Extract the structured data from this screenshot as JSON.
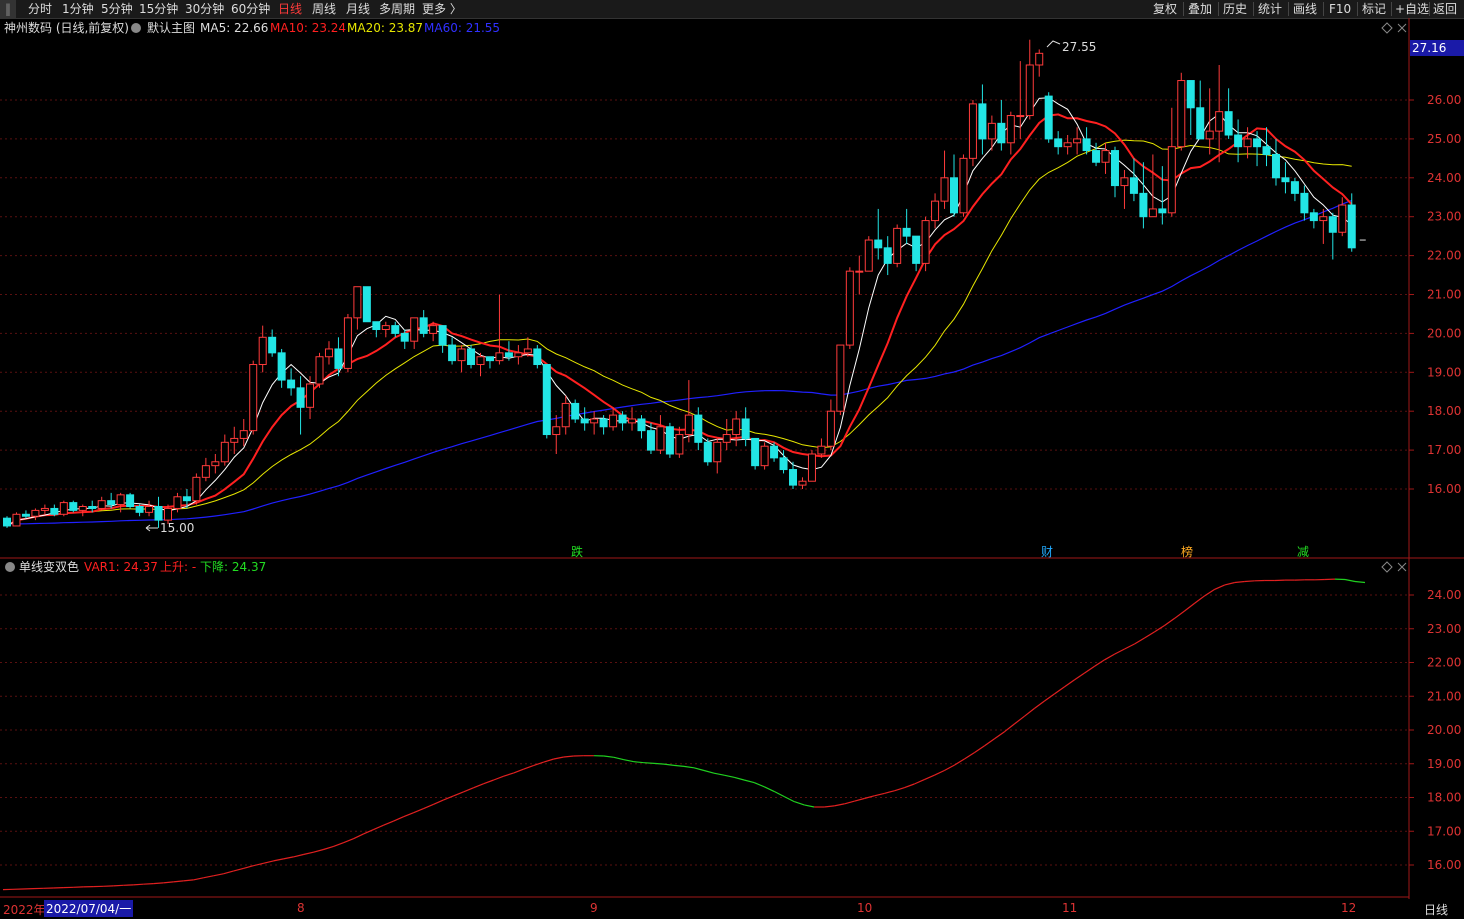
{
  "toolbar": {
    "periods": [
      "分时",
      "1分钟",
      "5分钟",
      "15分钟",
      "30分钟",
      "60分钟",
      "日线",
      "周线",
      "月线",
      "多周期",
      "更多 〉"
    ],
    "active_index": 6,
    "right": [
      "复权",
      "叠加",
      "历史",
      "统计",
      "画线",
      "F10",
      "标记",
      "+自选",
      "返回"
    ]
  },
  "main_header": {
    "stock": "神州数码 (日线,前复权)",
    "template": "默认主图",
    "ma5": "MA5: 22.66",
    "ma10": "MA10: 23.24",
    "ma20": "MA20: 23.87",
    "ma60": "MA60: 21.55",
    "current_price": "27.16"
  },
  "sub_header": {
    "name": "单线变双色",
    "var1": "VAR1: 24.37",
    "up": "上升: -",
    "down": "下降: 24.37"
  },
  "bottom": {
    "date_prefix": "2022年",
    "date_box": "2022/07/04/一",
    "months": [
      "8",
      "9",
      "10",
      "11",
      "12"
    ],
    "period_label": "日线"
  },
  "colors": {
    "up": "#ff3b3b",
    "down": "#22e5e5",
    "ma5": "#ffffff",
    "ma10": "#ff2020",
    "ma20": "#e6e600",
    "ma60": "#2020ff",
    "var_up": "#e02020",
    "var_down": "#20d020"
  },
  "chart_data": [
    {
      "type": "candlestick",
      "name": "main",
      "ylim": [
        15.0,
        27.5
      ],
      "yticks": [
        16.0,
        17.0,
        18.0,
        19.0,
        20.0,
        21.0,
        22.0,
        23.0,
        24.0,
        25.0,
        26.0
      ],
      "annotations": [
        {
          "text": "27.55",
          "type": "high"
        },
        {
          "text": "15.00",
          "type": "low"
        }
      ],
      "markers": [
        "跌",
        "财",
        "榜",
        "减"
      ],
      "ohlc": [
        [
          15.25,
          15.3,
          15.0,
          15.05
        ],
        [
          15.05,
          15.4,
          15.05,
          15.35
        ],
        [
          15.35,
          15.45,
          15.25,
          15.3
        ],
        [
          15.3,
          15.5,
          15.2,
          15.45
        ],
        [
          15.45,
          15.6,
          15.35,
          15.5
        ],
        [
          15.5,
          15.6,
          15.3,
          15.35
        ],
        [
          15.35,
          15.7,
          15.3,
          15.65
        ],
        [
          15.65,
          15.7,
          15.4,
          15.45
        ],
        [
          15.45,
          15.6,
          15.3,
          15.55
        ],
        [
          15.55,
          15.7,
          15.4,
          15.5
        ],
        [
          15.5,
          15.8,
          15.45,
          15.7
        ],
        [
          15.7,
          15.9,
          15.5,
          15.6
        ],
        [
          15.6,
          15.9,
          15.4,
          15.85
        ],
        [
          15.85,
          15.9,
          15.5,
          15.55
        ],
        [
          15.55,
          15.6,
          15.3,
          15.4
        ],
        [
          15.4,
          15.7,
          15.3,
          15.55
        ],
        [
          15.55,
          15.8,
          15.0,
          15.2
        ],
        [
          15.2,
          15.6,
          15.1,
          15.5
        ],
        [
          15.5,
          15.9,
          15.4,
          15.8
        ],
        [
          15.8,
          16.0,
          15.5,
          15.7
        ],
        [
          15.7,
          16.4,
          15.6,
          16.3
        ],
        [
          16.3,
          16.8,
          16.2,
          16.6
        ],
        [
          16.6,
          16.9,
          16.4,
          16.7
        ],
        [
          16.7,
          17.4,
          16.6,
          17.2
        ],
        [
          17.2,
          17.6,
          16.9,
          17.3
        ],
        [
          17.3,
          17.8,
          17.1,
          17.5
        ],
        [
          17.5,
          19.3,
          17.4,
          19.2
        ],
        [
          19.2,
          20.2,
          19.0,
          19.9
        ],
        [
          19.9,
          20.1,
          19.4,
          19.5
        ],
        [
          19.5,
          19.6,
          18.6,
          18.8
        ],
        [
          18.8,
          19.1,
          18.4,
          18.6
        ],
        [
          18.6,
          18.9,
          17.4,
          18.1
        ],
        [
          18.1,
          18.9,
          17.8,
          18.7
        ],
        [
          18.7,
          19.5,
          18.6,
          19.4
        ],
        [
          19.4,
          19.8,
          19.2,
          19.6
        ],
        [
          19.6,
          19.9,
          18.9,
          19.1
        ],
        [
          19.1,
          20.5,
          19.0,
          20.4
        ],
        [
          20.4,
          21.2,
          20.1,
          21.2
        ],
        [
          21.2,
          21.2,
          20.3,
          20.3
        ],
        [
          20.3,
          20.3,
          19.9,
          20.1
        ],
        [
          20.1,
          20.3,
          19.9,
          20.2
        ],
        [
          20.2,
          20.3,
          19.9,
          20.0
        ],
        [
          20.0,
          20.1,
          19.6,
          19.8
        ],
        [
          19.8,
          20.4,
          19.6,
          20.4
        ],
        [
          20.4,
          20.6,
          19.9,
          20.0
        ],
        [
          20.0,
          20.3,
          19.8,
          20.2
        ],
        [
          20.2,
          20.2,
          19.5,
          19.7
        ],
        [
          19.7,
          19.9,
          19.2,
          19.3
        ],
        [
          19.3,
          19.7,
          19.0,
          19.6
        ],
        [
          19.6,
          19.7,
          19.1,
          19.2
        ],
        [
          19.2,
          19.5,
          18.9,
          19.4
        ],
        [
          19.4,
          19.4,
          19.1,
          19.3
        ],
        [
          19.3,
          21.0,
          19.2,
          19.5
        ],
        [
          19.5,
          19.8,
          19.3,
          19.4
        ],
        [
          19.4,
          19.7,
          19.2,
          19.5
        ],
        [
          19.5,
          19.9,
          19.4,
          19.6
        ],
        [
          19.6,
          19.7,
          19.1,
          19.2
        ],
        [
          19.2,
          19.2,
          17.3,
          17.4
        ],
        [
          17.4,
          17.9,
          16.9,
          17.6
        ],
        [
          17.6,
          18.4,
          17.4,
          18.2
        ],
        [
          18.2,
          18.3,
          17.7,
          17.8
        ],
        [
          17.8,
          18.1,
          17.5,
          17.7
        ],
        [
          17.7,
          18.0,
          17.4,
          17.8
        ],
        [
          17.8,
          17.9,
          17.4,
          17.6
        ],
        [
          17.6,
          18.1,
          17.5,
          17.9
        ],
        [
          17.9,
          18.0,
          17.5,
          17.7
        ],
        [
          17.7,
          18.1,
          17.5,
          17.8
        ],
        [
          17.8,
          17.9,
          17.3,
          17.5
        ],
        [
          17.5,
          17.7,
          16.9,
          17.0
        ],
        [
          17.0,
          17.9,
          16.9,
          17.6
        ],
        [
          17.6,
          17.7,
          16.8,
          16.9
        ],
        [
          16.9,
          17.6,
          16.8,
          17.4
        ],
        [
          17.4,
          18.8,
          17.2,
          17.9
        ],
        [
          17.9,
          18.1,
          17.0,
          17.2
        ],
        [
          17.2,
          17.3,
          16.6,
          16.7
        ],
        [
          16.7,
          17.3,
          16.4,
          17.2
        ],
        [
          17.2,
          17.8,
          17.0,
          17.4
        ],
        [
          17.4,
          18.0,
          17.1,
          17.8
        ],
        [
          17.8,
          18.1,
          17.1,
          17.3
        ],
        [
          17.3,
          17.3,
          16.5,
          16.6
        ],
        [
          16.6,
          17.2,
          16.5,
          17.1
        ],
        [
          17.1,
          17.2,
          16.7,
          16.8
        ],
        [
          16.8,
          17.0,
          16.4,
          16.5
        ],
        [
          16.5,
          16.7,
          16.0,
          16.1
        ],
        [
          16.1,
          16.3,
          16.0,
          16.2
        ],
        [
          16.2,
          17.0,
          16.2,
          16.9
        ],
        [
          16.9,
          17.3,
          16.8,
          17.1
        ],
        [
          17.1,
          18.3,
          17.0,
          18.0
        ],
        [
          18.0,
          19.7,
          17.9,
          19.7
        ],
        [
          19.7,
          21.7,
          19.6,
          21.6
        ],
        [
          21.6,
          22.0,
          21.0,
          21.6
        ],
        [
          21.6,
          22.5,
          21.6,
          22.4
        ],
        [
          22.4,
          23.2,
          21.9,
          22.2
        ],
        [
          22.2,
          22.5,
          21.5,
          21.8
        ],
        [
          21.8,
          22.8,
          21.7,
          22.7
        ],
        [
          22.7,
          23.2,
          22.3,
          22.5
        ],
        [
          22.5,
          22.5,
          21.6,
          21.8
        ],
        [
          21.8,
          23.0,
          21.6,
          22.9
        ],
        [
          22.9,
          23.6,
          22.7,
          23.4
        ],
        [
          23.4,
          24.7,
          23.2,
          24.0
        ],
        [
          24.0,
          24.6,
          23.0,
          23.1
        ],
        [
          23.1,
          24.6,
          23.0,
          24.5
        ],
        [
          24.5,
          26.0,
          24.3,
          25.9
        ],
        [
          25.9,
          26.4,
          24.6,
          25.0
        ],
        [
          25.0,
          25.6,
          24.7,
          25.4
        ],
        [
          25.4,
          26.0,
          24.7,
          24.9
        ],
        [
          24.9,
          25.7,
          24.6,
          25.6
        ],
        [
          25.6,
          27.0,
          25.0,
          25.6
        ],
        [
          25.6,
          27.55,
          25.5,
          26.9
        ],
        [
          26.9,
          27.3,
          26.6,
          27.2
        ],
        [
          26.1,
          26.2,
          24.9,
          25.0
        ],
        [
          25.0,
          25.2,
          24.6,
          24.8
        ],
        [
          24.8,
          25.1,
          24.6,
          24.9
        ],
        [
          24.9,
          25.3,
          24.6,
          25.0
        ],
        [
          25.0,
          25.3,
          24.6,
          24.7
        ],
        [
          24.7,
          24.9,
          24.3,
          24.4
        ],
        [
          24.4,
          24.9,
          24.1,
          24.7
        ],
        [
          24.7,
          24.8,
          23.5,
          23.8
        ],
        [
          23.8,
          24.2,
          23.2,
          24.0
        ],
        [
          24.0,
          24.5,
          23.4,
          23.6
        ],
        [
          23.6,
          24.4,
          22.7,
          23.0
        ],
        [
          23.0,
          24.6,
          23.0,
          23.2
        ],
        [
          23.2,
          24.3,
          22.8,
          23.1
        ],
        [
          23.1,
          25.8,
          23.0,
          24.8
        ],
        [
          24.8,
          26.7,
          24.7,
          26.5
        ],
        [
          26.5,
          26.4,
          25.1,
          25.8
        ],
        [
          25.8,
          26.5,
          25.0,
          25.0
        ],
        [
          25.0,
          26.3,
          24.6,
          25.2
        ],
        [
          25.2,
          26.9,
          24.4,
          25.7
        ],
        [
          25.7,
          26.3,
          25.0,
          25.1
        ],
        [
          25.1,
          25.5,
          24.4,
          24.8
        ],
        [
          24.8,
          25.3,
          24.5,
          25.0
        ],
        [
          25.0,
          25.2,
          24.3,
          24.8
        ],
        [
          24.8,
          25.3,
          24.3,
          24.6
        ],
        [
          24.6,
          25.0,
          23.8,
          24.0
        ],
        [
          24.0,
          24.4,
          23.6,
          23.9
        ],
        [
          23.9,
          24.0,
          23.4,
          23.6
        ],
        [
          23.6,
          23.8,
          22.9,
          23.1
        ],
        [
          23.1,
          23.2,
          22.7,
          22.9
        ],
        [
          22.9,
          23.2,
          22.3,
          23.0
        ],
        [
          23.0,
          23.1,
          21.9,
          22.6
        ],
        [
          22.6,
          23.5,
          22.5,
          23.3
        ],
        [
          23.3,
          23.6,
          22.1,
          22.2
        ]
      ]
    },
    {
      "type": "line",
      "name": "单线变双色",
      "ylim": [
        15.0,
        25.0
      ],
      "yticks": [
        16.0,
        17.0,
        18.0,
        19.0,
        20.0,
        21.0,
        22.0,
        23.0,
        24.0
      ],
      "values": [
        15.27,
        15.28,
        15.29,
        15.3,
        15.31,
        15.32,
        15.33,
        15.34,
        15.35,
        15.36,
        15.37,
        15.38,
        15.4,
        15.41,
        15.43,
        15.45,
        15.47,
        15.5,
        15.53,
        15.56,
        15.62,
        15.68,
        15.74,
        15.82,
        15.9,
        15.98,
        16.05,
        16.12,
        16.18,
        16.24,
        16.31,
        16.38,
        16.46,
        16.55,
        16.66,
        16.78,
        16.92,
        17.05,
        17.18,
        17.3,
        17.43,
        17.55,
        17.67,
        17.8,
        17.93,
        18.05,
        18.17,
        18.29,
        18.41,
        18.52,
        18.63,
        18.73,
        18.84,
        18.95,
        19.05,
        19.14,
        19.2,
        19.23,
        19.24,
        19.24,
        19.23,
        19.19,
        19.12,
        19.06,
        19.03,
        19.01,
        18.99,
        18.95,
        18.92,
        18.88,
        18.8,
        18.72,
        18.66,
        18.6,
        18.52,
        18.44,
        18.32,
        18.18,
        18.03,
        17.88,
        17.78,
        17.72,
        17.72,
        17.75,
        17.81,
        17.89,
        17.97,
        18.05,
        18.12,
        18.2,
        18.29,
        18.4,
        18.53,
        18.66,
        18.8,
        18.96,
        19.14,
        19.33,
        19.53,
        19.74,
        19.95,
        20.18,
        20.41,
        20.64,
        20.86,
        21.07,
        21.28,
        21.49,
        21.69,
        21.89,
        22.08,
        22.25,
        22.4,
        22.55,
        22.73,
        22.91,
        23.1,
        23.31,
        23.53,
        23.76,
        23.98,
        24.17,
        24.3,
        24.37,
        24.4,
        24.42,
        24.43,
        24.43,
        24.44,
        24.44,
        24.45,
        24.45,
        24.46,
        24.47,
        24.46,
        24.4,
        24.37
      ]
    }
  ]
}
